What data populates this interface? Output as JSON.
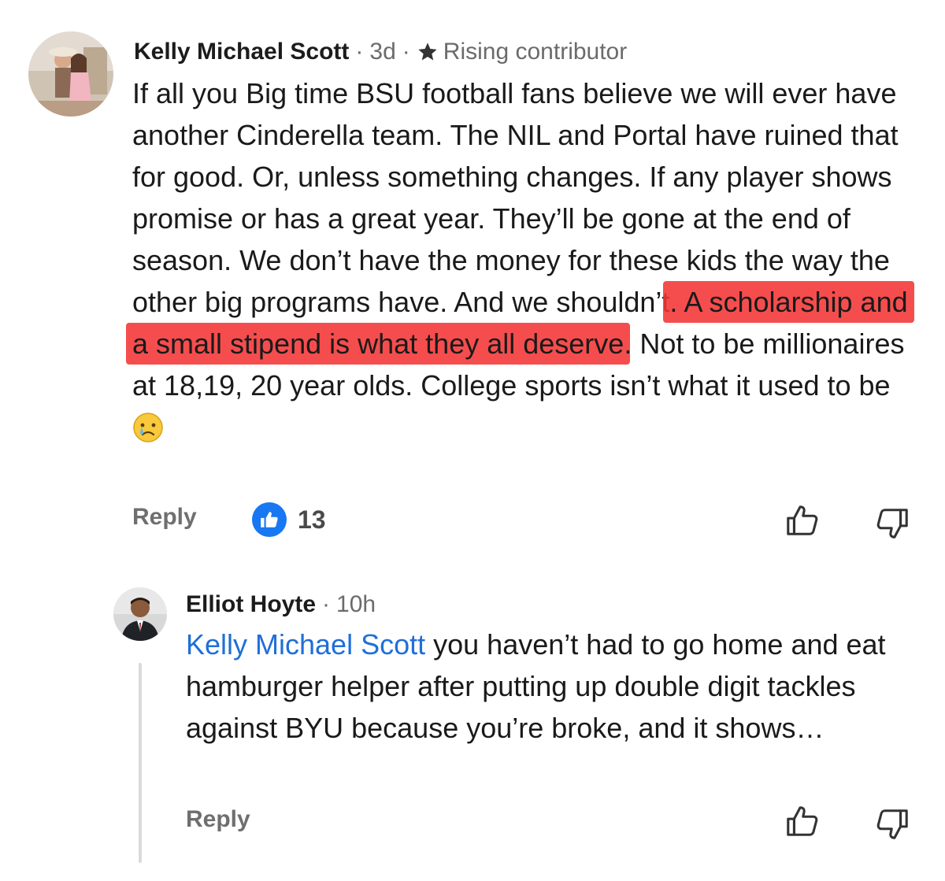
{
  "comments": [
    {
      "author": "Kelly Michael Scott",
      "separator1": "·",
      "time": "3d",
      "separator2": "·",
      "badge_icon": "star-icon",
      "badge": "Rising contributor",
      "text_before": "If all you Big time BSU football fans believe we will ever have another Cinderella team. The NIL and Portal have ruined that for good. Or, unless something changes. If any player shows promise or has a great year. They’ll be gone at the end of season. We don’t have the money for these kids the way the other big programs have. And we shouldn’t",
      "text_highlighted": ". A scholarship and a small stipend is what they all deserve",
      "text_after": ". Not to be millionaires at 18,19, 20 year olds. College sports isn’t what it used to be",
      "emoji": "crying-face-emoji",
      "highlight_color": "#f43434",
      "reply_label": "Reply",
      "like_count": "13",
      "like_badge_color": "#1877f2"
    },
    {
      "author": "Elliot Hoyte",
      "separator1": "·",
      "time": "10h",
      "mention": "Kelly Michael Scott",
      "mention_color": "#1f6fd8",
      "text": " you haven’t had to go home and eat hamburger helper after putting up double digit tackles against BYU because you’re broke, and it shows…",
      "reply_label": "Reply"
    }
  ]
}
